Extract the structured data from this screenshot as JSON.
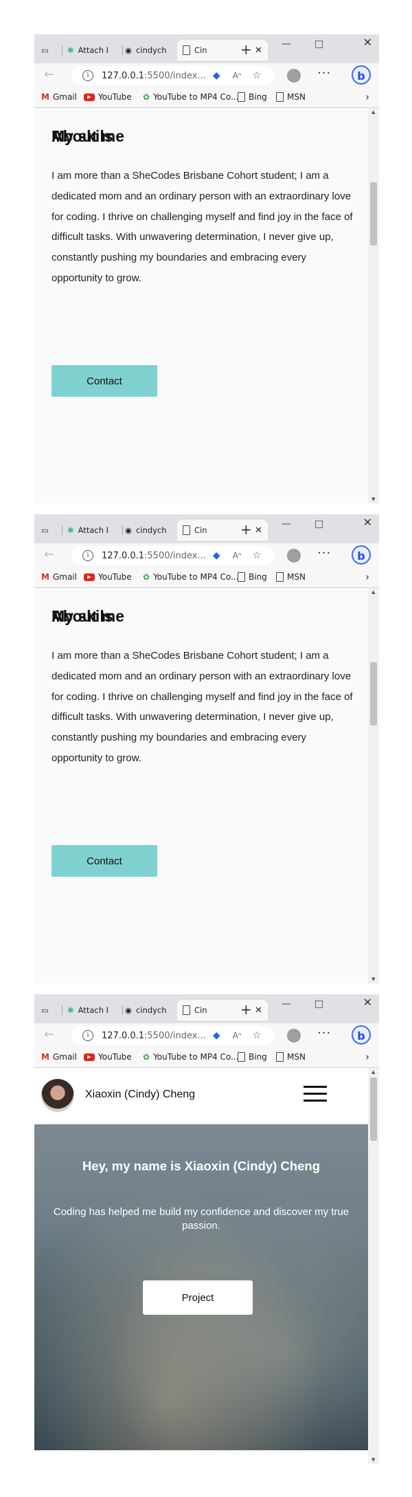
{
  "browser": {
    "tabs": [
      {
        "label": "Attach I",
        "icon": "openai-icon"
      },
      {
        "label": "cindych",
        "icon": "github-icon"
      },
      {
        "label": "Cin",
        "icon": "page-icon",
        "active": true
      }
    ],
    "url_host": "127.0.0.1",
    "url_rest": ":5500/index...",
    "bookmarks": [
      "Gmail",
      "YouTube",
      "YouTube to MP4 Co...",
      "Bing",
      "MSN"
    ],
    "accent": "#3b6bea"
  },
  "about": {
    "title": "About me",
    "text": "I am more than a SheCodes Brisbane Cohort student; I am a dedicated mom and an ordinary person with an extraordinary love for coding. I thrive on challenging myself and find joy in the face of difficult tasks. With unwavering determination, I never give up, constantly pushing my boundaries and embracing every opportunity to grow.",
    "contact_label": "Contact",
    "skills_title": "My skils",
    "button_color": "#7ed1cf"
  },
  "header": {
    "name": "Xiaoxin (Cindy) Cheng"
  },
  "hero": {
    "title": "Hey, my name is Xiaoxin (Cindy) Cheng",
    "subtitle": "Coding has helped me build my confidence and discover my true passion.",
    "project_label": "Project"
  }
}
